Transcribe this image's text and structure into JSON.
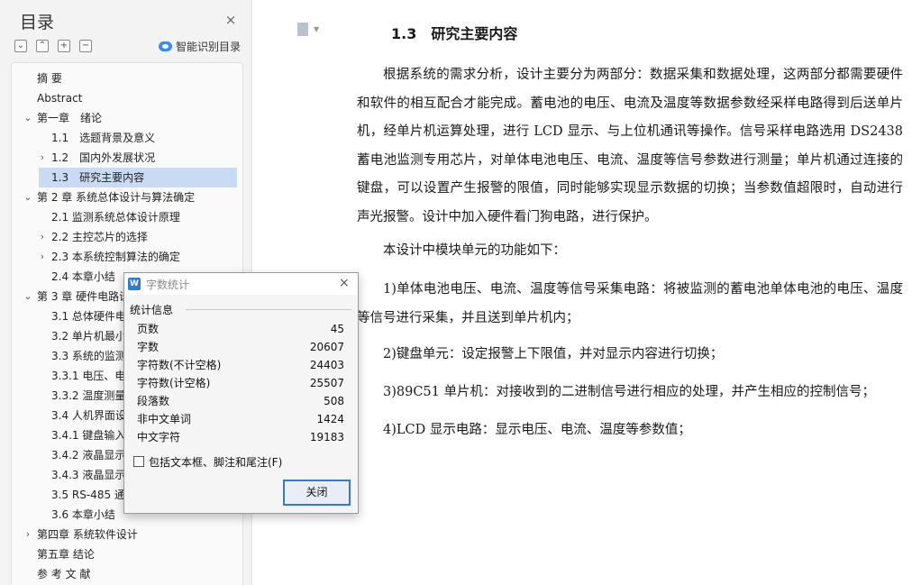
{
  "sidebar": {
    "title": "目录",
    "close_icon": "×",
    "tools": [
      "⌄",
      "⌃",
      "+",
      "−"
    ],
    "smart_toc_label": "智能识别目录",
    "items": [
      {
        "label": "摘  要",
        "chevron": ""
      },
      {
        "label": "Abstract",
        "chevron": ""
      },
      {
        "label": "第一章　绪论",
        "chevron": "⌄"
      },
      {
        "label": "1.1　选题背景及意义",
        "chevron": ""
      },
      {
        "label": "1.2　国内外发展状况",
        "chevron": "›"
      },
      {
        "label": "1.3　研究主要内容",
        "chevron": "",
        "selected": true
      },
      {
        "label": "第 2 章  系统总体设计与算法确定",
        "chevron": "⌄"
      },
      {
        "label": "2.1 监测系统总体设计原理",
        "chevron": ""
      },
      {
        "label": "2.2 主控芯片的选择",
        "chevron": "›"
      },
      {
        "label": "2.3 本系统控制算法的确定",
        "chevron": "›"
      },
      {
        "label": "2.4 本章小结",
        "chevron": ""
      },
      {
        "label": "第 3 章  硬件电路设计",
        "chevron": "⌄"
      },
      {
        "label": "3.1 总体硬件电路",
        "chevron": ""
      },
      {
        "label": "3.2 单片机最小系统",
        "chevron": ""
      },
      {
        "label": "3.3 系统的监测电路",
        "chevron": ""
      },
      {
        "label": "3.3.1 电压、电流",
        "chevron": ""
      },
      {
        "label": "3.3.2 温度测量",
        "chevron": ""
      },
      {
        "label": "3.4 人机界面设计",
        "chevron": ""
      },
      {
        "label": "3.4.1 键盘输入",
        "chevron": ""
      },
      {
        "label": "3.4.2 液晶显示",
        "chevron": ""
      },
      {
        "label": "3.4.3 液晶显示",
        "chevron": ""
      },
      {
        "label": "3.5 RS-485 通讯",
        "chevron": ""
      },
      {
        "label": "3.6 本章小结",
        "chevron": ""
      },
      {
        "label": "第四章  系统软件设计",
        "chevron": "›"
      },
      {
        "label": "第五章  结论",
        "chevron": ""
      },
      {
        "label": "参 考 文 献",
        "chevron": ""
      }
    ]
  },
  "document": {
    "heading": "1.3　研究主要内容",
    "paragraphs": [
      "根据系统的需求分析，设计主要分为两部分：数据采集和数据处理，这两部分都需要硬件和软件的相互配合才能完成。蓄电池的电压、电流及温度等数据参数经采样电路得到后送单片机，经单片机运算处理，进行 LCD 显示、与上位机通讯等操作。信号采样电路选用 DS2438 蓄电池监测专用芯片，对单体电池电压、电流、温度等信号参数进行测量；单片机通过连接的键盘，可以设置产生报警的限值，同时能够实现显示数据的切换；当参数值超限时，自动进行声光报警。设计中加入硬件看门狗电路，进行保护。",
      "本设计中模块单元的功能如下：",
      "1)单体电池电压、电流、温度等信号采集电路：将被监测的蓄电池单体电池的电压、温度等信号进行采集，并且送到单片机内；",
      "2)键盘单元：设定报警上下限值，并对显示内容进行切换；",
      "3)89C51 单片机：对接收到的二进制信号进行相应的处理，并产生相应的控制信号；",
      "4)LCD 显示电路：显示电压、电流、温度等参数值；"
    ]
  },
  "dialog": {
    "title": "字数统计",
    "logo": "W",
    "close_icon": "×",
    "section_label": "统计信息",
    "stats": [
      {
        "label": "页数",
        "value": "45"
      },
      {
        "label": "字数",
        "value": "20607"
      },
      {
        "label": "字符数(不计空格)",
        "value": "24403"
      },
      {
        "label": "字符数(计空格)",
        "value": "25507"
      },
      {
        "label": "段落数",
        "value": "508"
      },
      {
        "label": "非中文单词",
        "value": "1424"
      },
      {
        "label": "中文字符",
        "value": "19183"
      }
    ],
    "checkbox_label": "包括文本框、脚注和尾注(F)",
    "checkbox_checked": false,
    "close_button_label": "关闭"
  },
  "colors": {
    "accent": "#2d7bd6",
    "selection": "#c9daf3",
    "sidebar_bg": "#f3f3f3"
  }
}
